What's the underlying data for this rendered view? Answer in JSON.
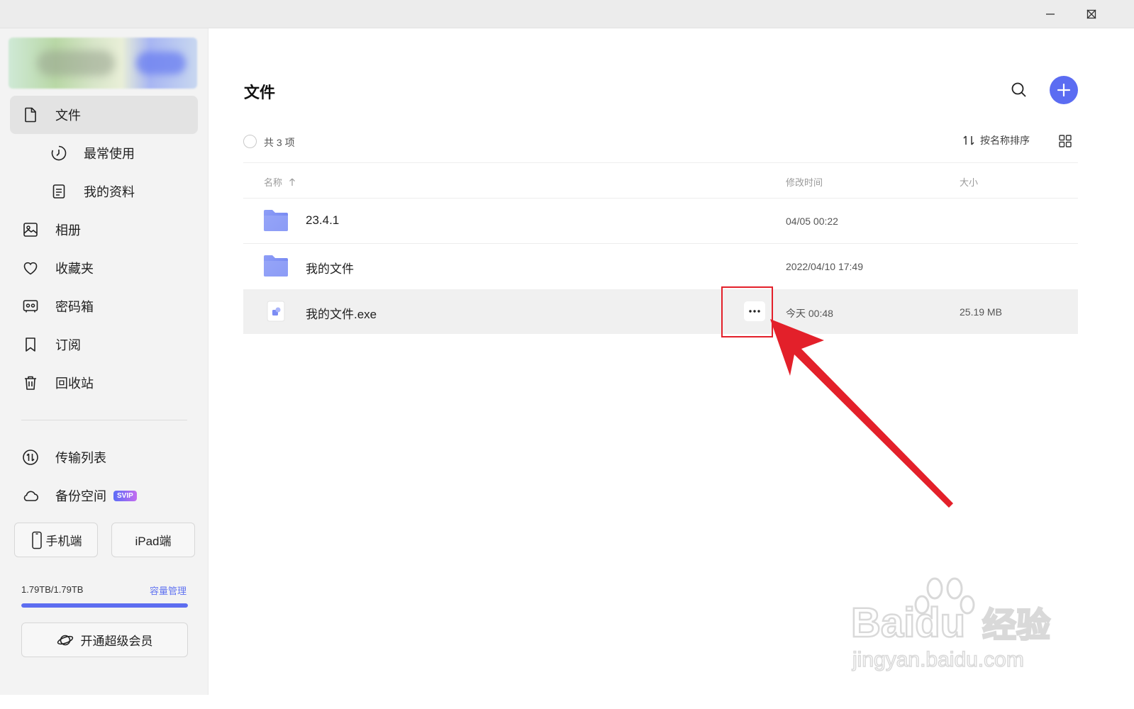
{
  "window": {
    "minimize_icon": "minimize-icon",
    "maximize_icon": "maximize-icon",
    "close_icon": "close-icon"
  },
  "sidebar": {
    "items": [
      {
        "label": "文件",
        "icon": "file-icon",
        "active": true
      },
      {
        "label": "最常使用",
        "icon": "clock-icon"
      },
      {
        "label": "我的资料",
        "icon": "document-icon"
      },
      {
        "label": "相册",
        "icon": "photo-icon"
      },
      {
        "label": "收藏夹",
        "icon": "heart-icon"
      },
      {
        "label": "密码箱",
        "icon": "safe-icon"
      },
      {
        "label": "订阅",
        "icon": "bookmark-icon"
      },
      {
        "label": "回收站",
        "icon": "trash-icon"
      }
    ],
    "transfer": {
      "label": "传输列表",
      "icon": "transfer-icon"
    },
    "backup": {
      "label": "备份空间",
      "badge": "SVIP",
      "icon": "cloud-icon"
    },
    "phone_button": "手机端",
    "ipad_button": "iPad端",
    "storage": {
      "text": "1.79TB/1.79TB",
      "manage_label": "容量管理",
      "used_fraction": 1.0
    },
    "vip_button": "开通超级会员"
  },
  "main": {
    "title": "文件",
    "count_label": "共 3 项",
    "sort_label": "按名称排序",
    "columns": {
      "name": "名称",
      "modified": "修改时间",
      "size": "大小"
    },
    "files": [
      {
        "name": "23.4.1",
        "modified": "04/05 00:22",
        "size": "",
        "type": "folder"
      },
      {
        "name": "我的文件",
        "modified": "2022/04/10 17:49",
        "size": "",
        "type": "folder"
      },
      {
        "name": "我的文件.exe",
        "modified": "今天 00:48",
        "size": "25.19 MB",
        "type": "exe"
      }
    ]
  },
  "watermark": {
    "brand": "Baidu",
    "brand_cn": "经验",
    "url": "jingyan.baidu.com"
  },
  "colors": {
    "accent": "#5b6cf2",
    "highlight": "#e3202a"
  }
}
